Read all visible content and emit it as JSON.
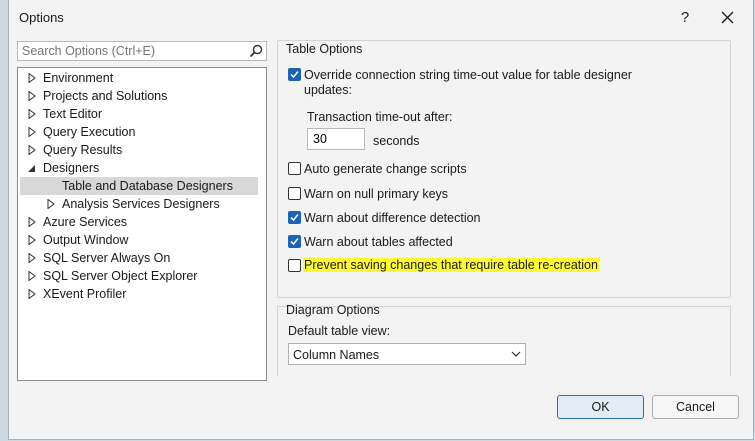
{
  "window": {
    "title": "Options",
    "help_label": "?"
  },
  "search": {
    "placeholder": "Search Options (Ctrl+E)"
  },
  "tree": {
    "items": [
      {
        "label": "Environment",
        "expanded": false
      },
      {
        "label": "Projects and Solutions",
        "expanded": false
      },
      {
        "label": "Text Editor",
        "expanded": false
      },
      {
        "label": "Query Execution",
        "expanded": false
      },
      {
        "label": "Query Results",
        "expanded": false
      },
      {
        "label": "Designers",
        "expanded": true
      },
      {
        "label": "Table and Database Designers",
        "selected": true
      },
      {
        "label": "Analysis Services Designers",
        "expanded": false
      },
      {
        "label": "Azure Services",
        "expanded": false
      },
      {
        "label": "Output Window",
        "expanded": false
      },
      {
        "label": "SQL Server Always On",
        "expanded": false
      },
      {
        "label": "SQL Server Object Explorer",
        "expanded": false
      },
      {
        "label": "XEvent Profiler",
        "expanded": false
      }
    ]
  },
  "table_options": {
    "title": "Table Options",
    "override": {
      "line1": "Override connection string time-out value for table designer",
      "line2": "updates:",
      "checked": true
    },
    "timeout_label": "Transaction time-out after:",
    "timeout_value": "30",
    "seconds_label": "seconds",
    "auto_generate": {
      "label": "Auto generate change scripts",
      "checked": false
    },
    "warn_null": {
      "label": "Warn on null primary keys",
      "checked": false
    },
    "warn_difference": {
      "label": "Warn about difference detection",
      "checked": true
    },
    "warn_tables": {
      "label": "Warn about tables affected",
      "checked": true
    },
    "prevent_saving": {
      "label": "Prevent saving changes that require table re-creation",
      "checked": false
    }
  },
  "diagram_options": {
    "title": "Diagram Options",
    "default_view_label": "Default table view:",
    "default_view_value": "Column Names"
  },
  "buttons": {
    "ok": "OK",
    "cancel": "Cancel"
  },
  "colors": {
    "accent": "#1a63b8",
    "highlight": "#fffb2e",
    "selected_row": "#d8d8d8"
  }
}
